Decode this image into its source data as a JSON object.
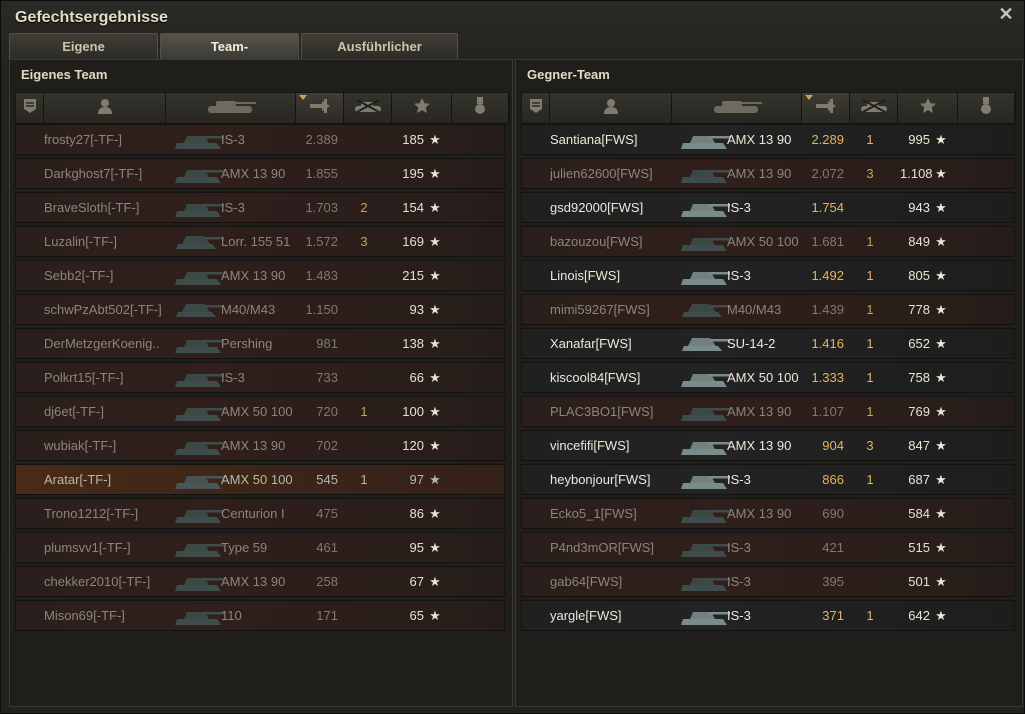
{
  "window": {
    "title": "Gefechtsergebnisse",
    "close_glyph": "✕"
  },
  "tabs": [
    "Eigene Auswertung",
    "Team-Auswertung",
    "Ausführlicher Bericht"
  ],
  "active_tab": 1,
  "icons": {
    "header": [
      "platoon-icon",
      "player-icon",
      "tank-icon",
      "damage-icon",
      "kills-icon",
      "xp-icon",
      "medal-icon"
    ],
    "xp_star": "★"
  },
  "own_team": {
    "title": "Eigenes Team",
    "rows": [
      {
        "name": "frosty27[-TF-]",
        "tank": "IS-3",
        "damage": "2.389",
        "kills": "",
        "xp": "185",
        "state": "dead"
      },
      {
        "name": "Darkghost7[-TF-]",
        "tank": "AMX 13 90",
        "damage": "1.855",
        "kills": "",
        "xp": "195",
        "state": "dead"
      },
      {
        "name": "BraveSloth[-TF-]",
        "tank": "IS-3",
        "damage": "1.703",
        "kills": "2",
        "xp": "154",
        "state": "dead"
      },
      {
        "name": "Luzalin[-TF-]",
        "tank": "Lorr. 155 51",
        "damage": "1.572",
        "kills": "3",
        "xp": "169",
        "state": "dead"
      },
      {
        "name": "Sebb2[-TF-]",
        "tank": "AMX 13 90",
        "damage": "1.483",
        "kills": "",
        "xp": "215",
        "state": "dead"
      },
      {
        "name": "schwPzAbt502[-TF-]",
        "tank": "M40/M43",
        "damage": "1.150",
        "kills": "",
        "xp": "93",
        "state": "dead"
      },
      {
        "name": "DerMetzgerKoenig..",
        "tank": "Pershing",
        "damage": "981",
        "kills": "",
        "xp": "138",
        "state": "dead"
      },
      {
        "name": "Polkrt15[-TF-]",
        "tank": "IS-3",
        "damage": "733",
        "kills": "",
        "xp": "66",
        "state": "dead"
      },
      {
        "name": "dj6et[-TF-]",
        "tank": "AMX 50 100",
        "damage": "720",
        "kills": "1",
        "xp": "100",
        "state": "dead"
      },
      {
        "name": "wubiak[-TF-]",
        "tank": "AMX 13 90",
        "damage": "702",
        "kills": "",
        "xp": "120",
        "state": "dead"
      },
      {
        "name": "Aratar[-TF-]",
        "tank": "AMX 50 100",
        "damage": "545",
        "kills": "1",
        "xp": "97",
        "state": "me"
      },
      {
        "name": "Trono1212[-TF-]",
        "tank": "Centurion I",
        "damage": "475",
        "kills": "",
        "xp": "86",
        "state": "dead"
      },
      {
        "name": "plumsvv1[-TF-]",
        "tank": "Type 59",
        "damage": "461",
        "kills": "",
        "xp": "95",
        "state": "dead"
      },
      {
        "name": "chekker2010[-TF-]",
        "tank": "AMX 13 90",
        "damage": "258",
        "kills": "",
        "xp": "67",
        "state": "dead"
      },
      {
        "name": "Mison69[-TF-]",
        "tank": "110",
        "damage": "171",
        "kills": "",
        "xp": "65",
        "state": "dead"
      }
    ]
  },
  "enemy_team": {
    "title": "Gegner-Team",
    "rows": [
      {
        "name": "Santiana[FWS]",
        "tank": "AMX 13 90",
        "damage": "2.289",
        "kills": "1",
        "xp": "995",
        "state": "alive"
      },
      {
        "name": "julien62600[FWS]",
        "tank": "AMX 13 90",
        "damage": "2.072",
        "kills": "3",
        "xp": "1.108",
        "state": "dead"
      },
      {
        "name": "gsd92000[FWS]",
        "tank": "IS-3",
        "damage": "1.754",
        "kills": "",
        "xp": "943",
        "state": "alive"
      },
      {
        "name": "bazouzou[FWS]",
        "tank": "AMX 50 100",
        "damage": "1.681",
        "kills": "1",
        "xp": "849",
        "state": "dead"
      },
      {
        "name": "Linois[FWS]",
        "tank": "IS-3",
        "damage": "1.492",
        "kills": "1",
        "xp": "805",
        "state": "alive"
      },
      {
        "name": "mimi59267[FWS]",
        "tank": "M40/M43",
        "damage": "1.439",
        "kills": "1",
        "xp": "778",
        "state": "dead"
      },
      {
        "name": "Xanafar[FWS]",
        "tank": "SU-14-2",
        "damage": "1.416",
        "kills": "1",
        "xp": "652",
        "state": "alive"
      },
      {
        "name": "kiscool84[FWS]",
        "tank": "AMX 50 100",
        "damage": "1.333",
        "kills": "1",
        "xp": "758",
        "state": "alive"
      },
      {
        "name": "PLAC3BO1[FWS]",
        "tank": "AMX 13 90",
        "damage": "1.107",
        "kills": "1",
        "xp": "769",
        "state": "dead"
      },
      {
        "name": "vincefifi[FWS]",
        "tank": "AMX 13 90",
        "damage": "904",
        "kills": "3",
        "xp": "847",
        "state": "alive"
      },
      {
        "name": "heybonjour[FWS]",
        "tank": "IS-3",
        "damage": "866",
        "kills": "1",
        "xp": "687",
        "state": "alive"
      },
      {
        "name": "Ecko5_1[FWS]",
        "tank": "AMX 13 90",
        "damage": "690",
        "kills": "",
        "xp": "584",
        "state": "dead"
      },
      {
        "name": "P4nd3mOR[FWS]",
        "tank": "IS-3",
        "damage": "421",
        "kills": "",
        "xp": "515",
        "state": "dead"
      },
      {
        "name": "gab64[FWS]",
        "tank": "IS-3",
        "damage": "395",
        "kills": "",
        "xp": "501",
        "state": "dead"
      },
      {
        "name": "yargle[FWS]",
        "tank": "IS-3",
        "damage": "371",
        "kills": "1",
        "xp": "642",
        "state": "alive"
      }
    ]
  }
}
